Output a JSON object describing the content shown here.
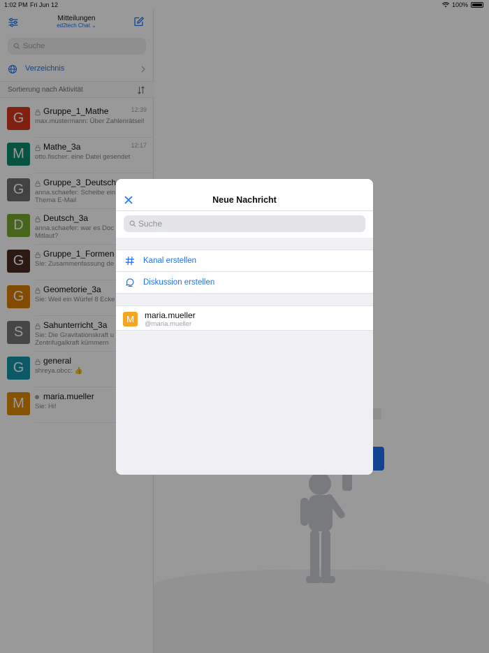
{
  "status_bar": {
    "time": "1:02 PM",
    "date": "Fri Jun 12",
    "battery": "100%"
  },
  "sidebar": {
    "title": "Mitteilungen",
    "server": "ed2tech Chat",
    "search_placeholder": "Suche",
    "directory_label": "Verzeichnis",
    "sort_label": "Sortierung nach Aktivität",
    "rooms": [
      {
        "initial": "G",
        "color": "#d4361b",
        "name": "Gruppe_1_Mathe",
        "time": "12:39",
        "message": "max.mustermann: Über Zahlenrätsel!",
        "type": "lock"
      },
      {
        "initial": "M",
        "color": "#0b8a6e",
        "name": "Mathe_3a",
        "time": "12:17",
        "message": "otto.fischer: eine Datei gesendet",
        "type": "lock"
      },
      {
        "initial": "G",
        "color": "#6e6e6e",
        "name": "Gruppe_3_Deutsch",
        "time": "",
        "message": "anna.schaefer: Scheibe ein über das Thema E-Mail",
        "type": "lock"
      },
      {
        "initial": "D",
        "color": "#78a832",
        "name": "Deutsch_3a",
        "time": "",
        "message": "anna.schaefer: war es Doc oder Mitlaut?",
        "type": "lock"
      },
      {
        "initial": "G",
        "color": "#4a2a22",
        "name": "Gruppe_1_Formen",
        "time": "",
        "message": "Sie: Zusammenfassung de",
        "type": "lock"
      },
      {
        "initial": "G",
        "color": "#d97f00",
        "name": "Geometorie_3a",
        "time": "",
        "message": "Sie: Weil ein Würfel 8 Ecke",
        "type": "lock"
      },
      {
        "initial": "S",
        "color": "#757575",
        "name": "Sahunterricht_3a",
        "time": "",
        "message": "Sie: Die Gravitationskraft u Zentrifugalkraft kümmern",
        "type": "lock"
      },
      {
        "initial": "G",
        "color": "#1494a8",
        "name": "general",
        "time": "",
        "message": "shreya.obcc: 👍",
        "type": "lock"
      },
      {
        "initial": "M",
        "color": "#e08a00",
        "name": "maria.mueller",
        "time": "",
        "message": "Sie: Hi!",
        "type": "dot"
      }
    ]
  },
  "modal": {
    "title": "Neue Nachricht",
    "search_placeholder": "Suche",
    "create_channel_label": "Kanal erstellen",
    "create_discussion_label": "Diskussion erstellen",
    "user": {
      "initial": "M",
      "name": "maria.mueller",
      "handle": "@maria.mueller"
    }
  },
  "colors": {
    "accent": "#1d74f5",
    "overlay": "rgba(0,0,0,0.40)",
    "user_avatar": "#f5a623"
  }
}
